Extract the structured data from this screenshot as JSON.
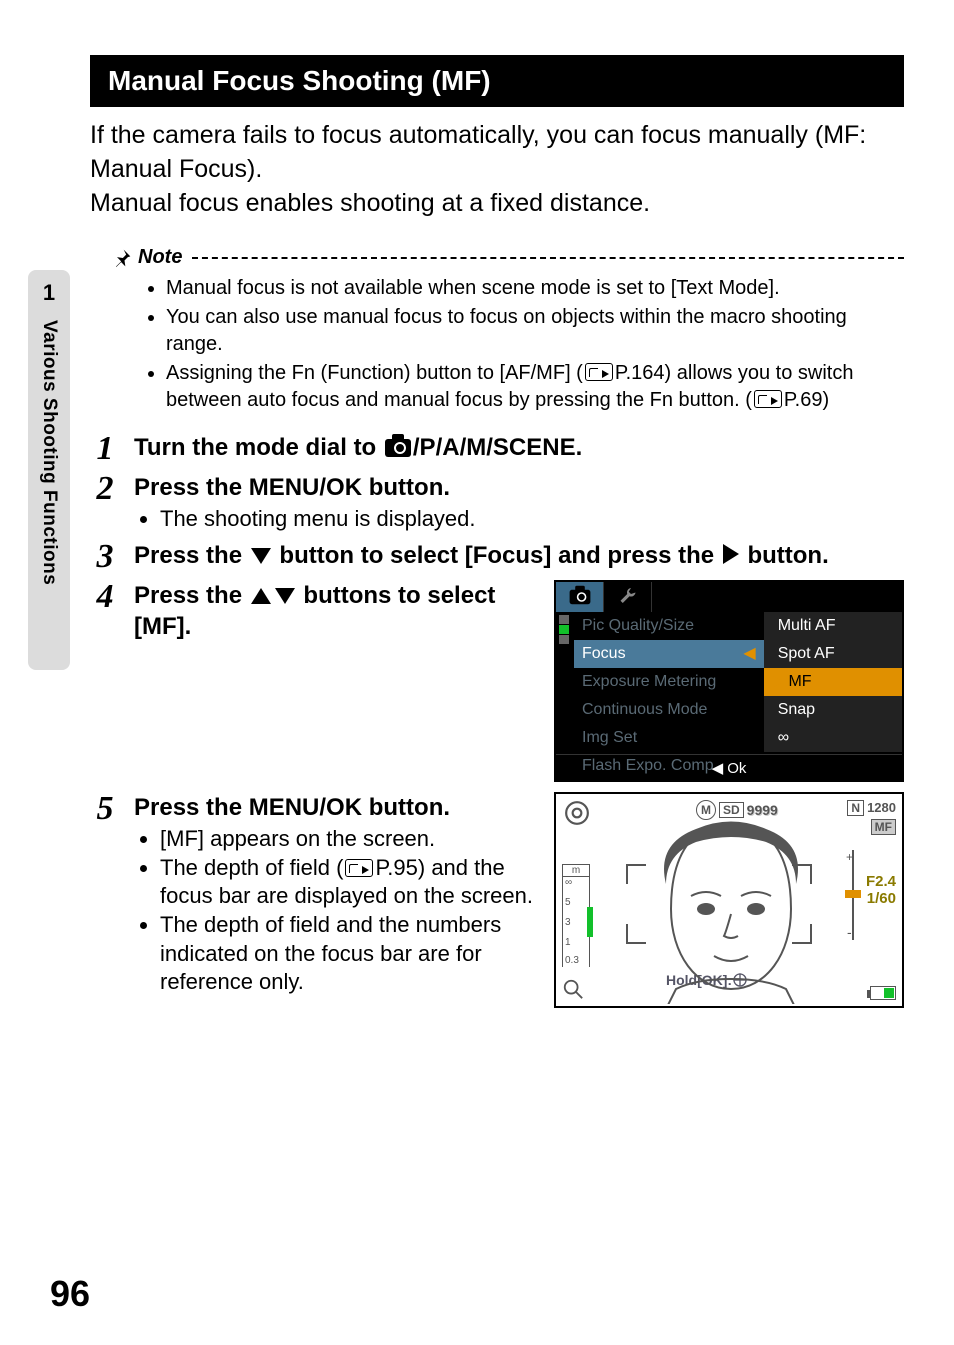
{
  "sidebar": {
    "chapter": "1",
    "title": "Various Shooting Functions"
  },
  "section_title": "Manual Focus Shooting (MF)",
  "intro": "If the camera fails to focus automatically, you can focus manually (MF: Manual Focus).\nManual focus enables shooting at a fixed distance.",
  "note": {
    "label": "Note",
    "items": [
      "Manual focus is not available when scene mode is set to [Text Mode].",
      "You can also use manual focus to focus on objects within the macro shooting range.",
      {
        "pre": "Assigning the Fn (Function) button to [AF/MF] (",
        "ref1": "P.164",
        "mid": ") allows you to switch between auto focus and manual focus by pressing the Fn button. (",
        "ref2": "P.69",
        "post": ")"
      }
    ]
  },
  "steps": [
    {
      "n": "1",
      "title_pre": "Turn the mode dial to ",
      "title_post": "/P/A/M/SCENE."
    },
    {
      "n": "2",
      "title": "Press the MENU/OK button.",
      "subs": [
        "The shooting menu is displayed."
      ]
    },
    {
      "n": "3",
      "title_pre": "Press the ",
      "title_mid": " button to select [Focus] and press the ",
      "title_post": " button."
    },
    {
      "n": "4",
      "title_pre": "Press the ",
      "title_post": " buttons to select [MF].",
      "menu": {
        "left_items": [
          "Pic Quality/Size",
          "Focus",
          "Exposure Metering",
          "Continuous Mode",
          "Img Set",
          "Flash Expo. Comp."
        ],
        "right_items": [
          "Multi AF",
          "Spot AF",
          "MF",
          "Snap",
          "∞"
        ],
        "selected_left": "Focus",
        "selected_right": "MF",
        "footer": "◀ Ok"
      }
    },
    {
      "n": "5",
      "title": "Press the MENU/OK button.",
      "subs": [
        "[MF] appears on the screen.",
        {
          "pre": "The depth of field (",
          "ref": "P.95",
          "post": ") and the focus bar are displayed on the screen."
        },
        "The depth of field and the numbers indicated on the focus bar are for reference only."
      ],
      "lcd": {
        "top_right_badges": [
          "N",
          "1280",
          "MF"
        ],
        "top_center": [
          "M",
          "SD",
          "9999"
        ],
        "right_vals": [
          "F2.4",
          "1/60"
        ],
        "bottom_text": "Hold[OK]:",
        "left_scale": [
          "m",
          "∞",
          "5",
          "3",
          "1",
          "0.3"
        ]
      }
    }
  ],
  "page_number": "96"
}
